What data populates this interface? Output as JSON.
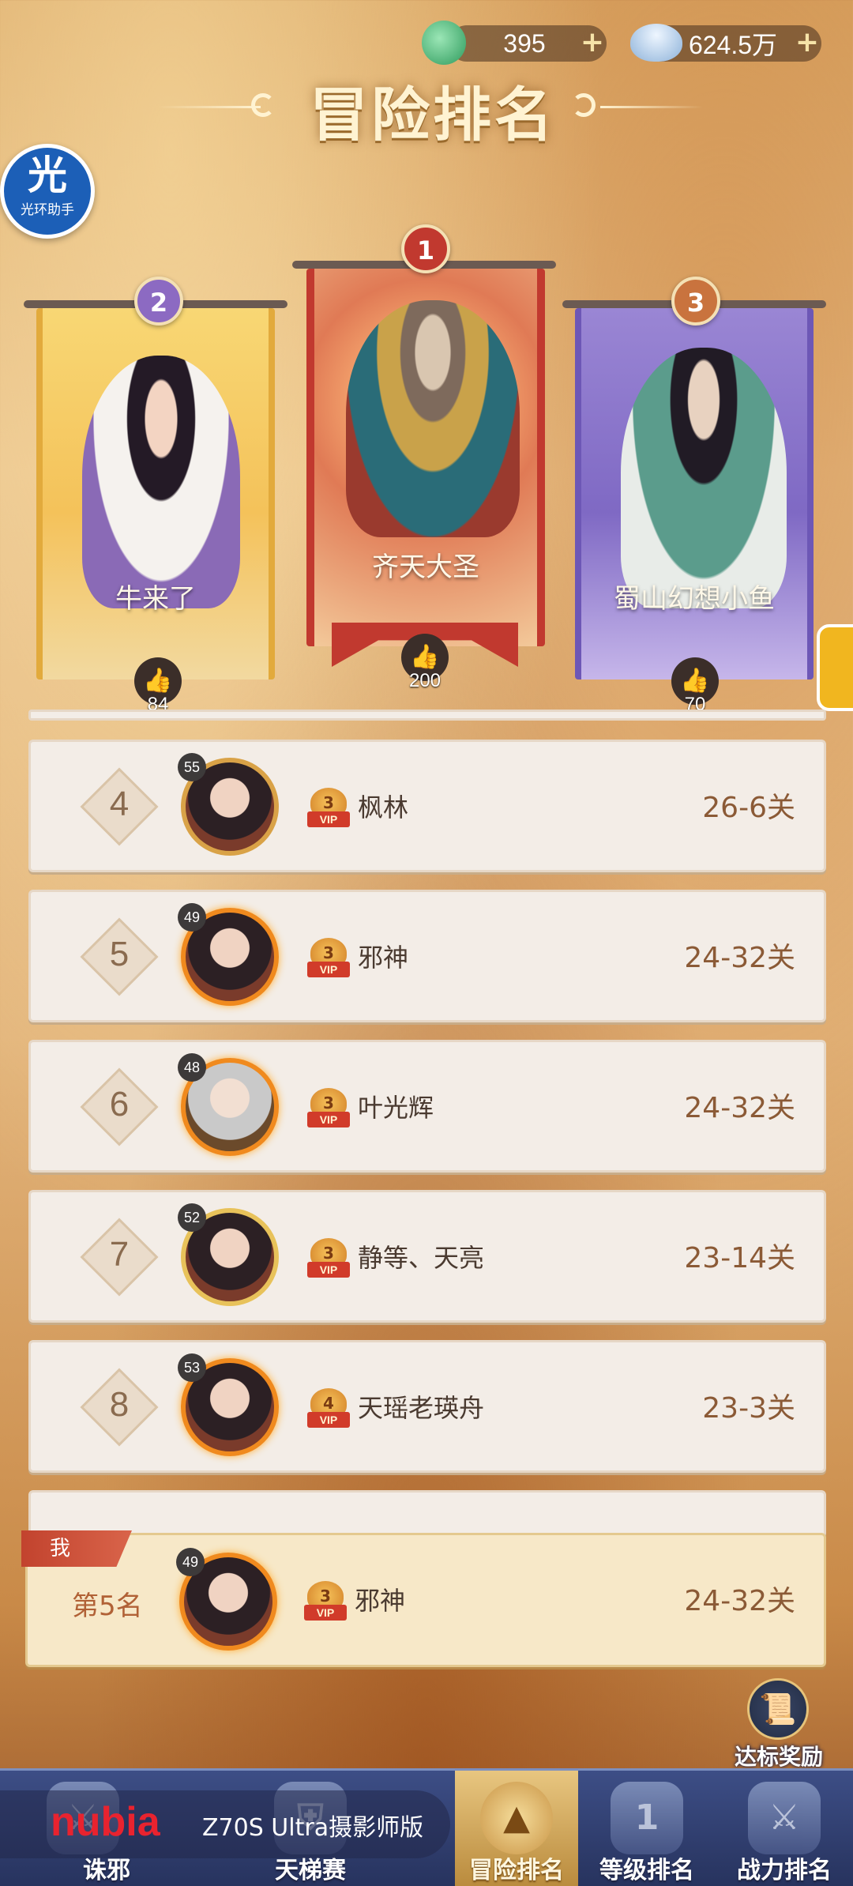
{
  "currencies": [
    {
      "icon": "jade-icon",
      "value": "395"
    },
    {
      "icon": "silver-ingot-icon",
      "value": "624.5万"
    }
  ],
  "page_title": "冒险排名",
  "assistant": {
    "label": "光环助手",
    "glyph": "光"
  },
  "podium": [
    {
      "rank": "2",
      "name": "牛来了",
      "likes": "84"
    },
    {
      "rank": "1",
      "name": "齐天大圣",
      "likes": "200"
    },
    {
      "rank": "3",
      "name": "蜀山幻想小鱼",
      "likes": "70"
    }
  ],
  "rows": [
    {
      "rank": "4",
      "level": "55",
      "vip": "3",
      "vip_label": "VIP",
      "name": "枫林",
      "stage": "26-6关"
    },
    {
      "rank": "5",
      "level": "49",
      "vip": "3",
      "vip_label": "VIP",
      "name": "邪神",
      "stage": "24-32关"
    },
    {
      "rank": "6",
      "level": "48",
      "vip": "3",
      "vip_label": "VIP",
      "name": "叶光辉",
      "stage": "24-32关"
    },
    {
      "rank": "7",
      "level": "52",
      "vip": "3",
      "vip_label": "VIP",
      "name": "静等、天亮",
      "stage": "23-14关"
    },
    {
      "rank": "8",
      "level": "53",
      "vip": "4",
      "vip_label": "VIP",
      "name": "天瑶老瑛舟",
      "stage": "23-3关"
    }
  ],
  "self": {
    "tag": "我",
    "rank_text": "第5名",
    "level": "49",
    "vip": "3",
    "vip_label": "VIP",
    "name": "邪神",
    "stage": "24-32关"
  },
  "reward": {
    "label": "达标奖励"
  },
  "watermark": {
    "brand": "nubia",
    "model": "Z70S Ultra摄影师版"
  },
  "nav": [
    {
      "label": "诛邪",
      "active": false
    },
    {
      "label": "天梯赛",
      "active": false
    },
    {
      "label": "冒险排名",
      "active": true
    },
    {
      "label": "等级排名",
      "active": false
    },
    {
      "label": "战力排名",
      "active": false
    }
  ],
  "colors": {
    "accent": "#d13b2a",
    "gold": "#e6c37a",
    "nav_bg": "#27335e"
  }
}
